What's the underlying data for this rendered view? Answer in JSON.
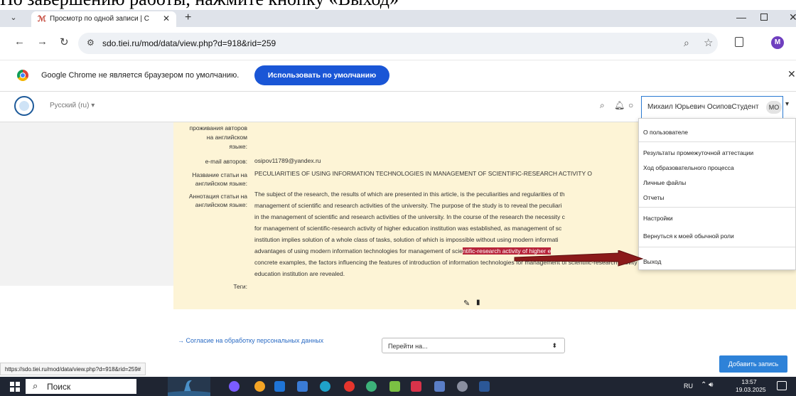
{
  "caption": "По завершению работы, нажмите кнопку «Выход»",
  "browser": {
    "tab_title": "Просмотр по одной записи | С",
    "tab_close": "✕",
    "new_tab": "+",
    "url": "sdo.tiei.ru/mod/data/view.php?d=918&rid=259",
    "profile_initial": "M"
  },
  "infobar": {
    "message": "Google Chrome не является браузером по умолчанию.",
    "button": "Использовать по умолчанию",
    "close": "✕"
  },
  "moodle": {
    "language": "Русский (ru) ▾",
    "user_name": "Михаил Юрьевич ОсиповСтудент",
    "user_initials": "МО",
    "user_caret": "▾"
  },
  "record": {
    "partial_label": "проживания авторов",
    "label_english_1": "на английском",
    "label_english_2": "языке:",
    "email_label": "e-mail авторов:",
    "email_value": "osipov11789@yandex.ru",
    "title_label_1": "Название статьи на",
    "title_label_2": "английском языке:",
    "title_value": "PECULIARITIES OF USING INFORMATION TECHNOLOGIES IN MANAGEMENT OF SCIENTIFIC-RESEARCH ACTIVITY O",
    "abstract_label_1": "Аннотация статьи на",
    "abstract_label_2": "английском языке:",
    "abstract_line_1": "The subject of the research, the results of which are presented in this article, is the peculiarities and regularities of th",
    "abstract_line_2": "management of scientific and research activities of the university. The purpose of the study is to reveal the peculiari",
    "abstract_line_3": "in the management of scientific and research activities of the university. In the course of the research the necessity c",
    "abstract_line_4": "for management of scientific-research activity of higher education institution was established, as management of sc",
    "abstract_line_5": "institution implies solution of a whole class of tasks, solution of which is impossible without using modern informati",
    "abstract_line_6_start": "advantages of using modern information technologies for management of scie",
    "abstract_line_6_highlight": "ntific-research activity of higher e",
    "abstract_line_7": "concrete examples, the factors influencing the features of introduction of information technologies for management of scientific-research activity of higher",
    "abstract_line_8": "education institution are revealed.",
    "tags_label": "Теги:"
  },
  "user_dropdown": {
    "items": [
      "О пользователе",
      "Результаты промежуточной аттестации",
      "Ход образовательного процесса",
      "Личные файлы",
      "Отчеты",
      "Настройки",
      "Вернуться к моей обычной роли",
      "Выход"
    ]
  },
  "footer": {
    "consent_link": "→ Согласие на обработку персональных данных",
    "jump_select": "Перейти на...",
    "add_record": "Добавить запись",
    "status_url": "https://sdo.tiei.ru/mod/data/view.php?d=918&rid=259#"
  },
  "taskbar": {
    "search_placeholder": "Поиск",
    "lang": "RU",
    "time": "13:57",
    "date": "19.03.2025"
  },
  "colors": {
    "accent": "#1a56d6",
    "card_background": "#fdf4d6",
    "highlight": "#b7243a",
    "arrow": "#8b1a1a",
    "taskbar": "#1f2532"
  }
}
